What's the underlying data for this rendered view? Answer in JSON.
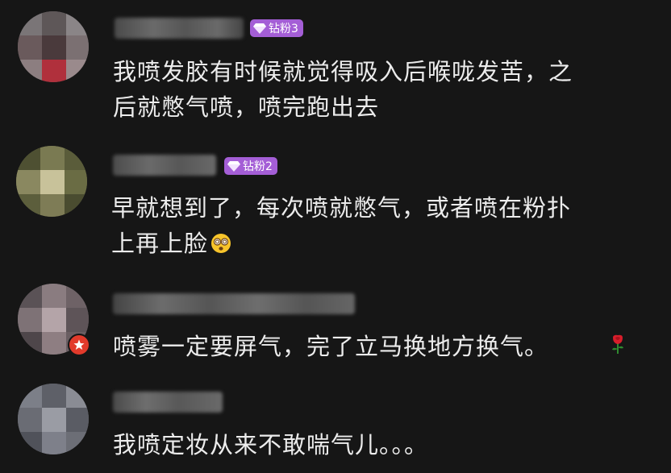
{
  "comments": [
    {
      "badge": "钻粉3",
      "lines": [
        "我喷发胶有时候就觉得吸入后喉咙发苦，之",
        "后就憋气喷，喷完跑出去"
      ]
    },
    {
      "badge": "钻粉2",
      "lines": [
        "早就想到了，每次喷就憋气，或者喷在粉扑",
        "上再上脸"
      ],
      "trailing_emoji": "dizzy-face-emoji"
    },
    {
      "badge": "",
      "lines": [
        "喷雾一定要屏气，完了立马换地方换气。"
      ],
      "trailing_emoji": "rose-emoji",
      "avatar_badge_icon": "star-rank-icon"
    },
    {
      "badge": "",
      "lines": [
        "我喷定妆从来不敢喘气儿。。。"
      ]
    }
  ],
  "colors": {
    "background": "#161616",
    "text": "#ececec",
    "badge": "#a45ed6",
    "rank_badge": "#e23a2b"
  }
}
